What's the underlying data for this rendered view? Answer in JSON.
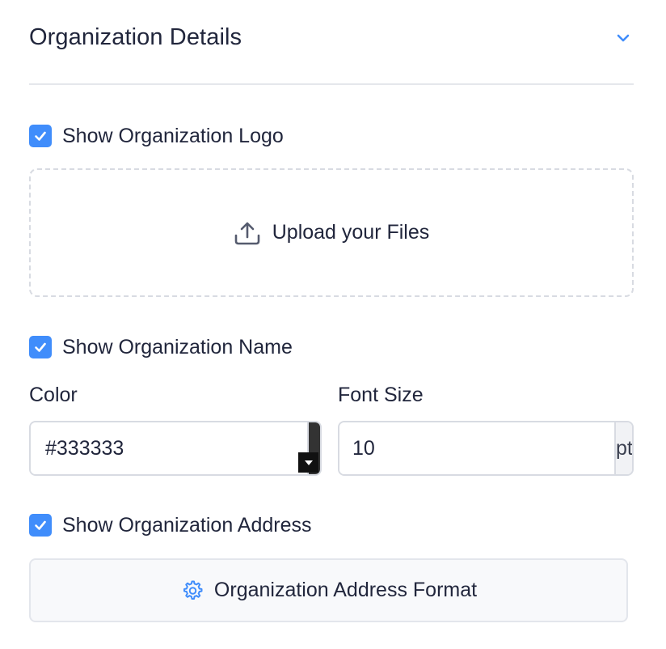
{
  "colors": {
    "accent": "#408dfb",
    "swatch": "#333333"
  },
  "header": {
    "title": "Organization Details",
    "toggle_icon": "chevron-down-icon"
  },
  "logo": {
    "checkbox_label": "Show Organization Logo",
    "checked": true,
    "upload_label": "Upload your Files",
    "upload_icon": "upload-icon"
  },
  "name": {
    "checkbox_label": "Show Organization Name",
    "checked": true,
    "color_label": "Color",
    "color_value": "#333333",
    "font_size_label": "Font Size",
    "font_size_value": "10",
    "font_size_unit": "pt"
  },
  "address": {
    "checkbox_label": "Show Organization Address",
    "checked": true,
    "format_button_label": "Organization Address Format",
    "format_icon": "gear-icon"
  }
}
